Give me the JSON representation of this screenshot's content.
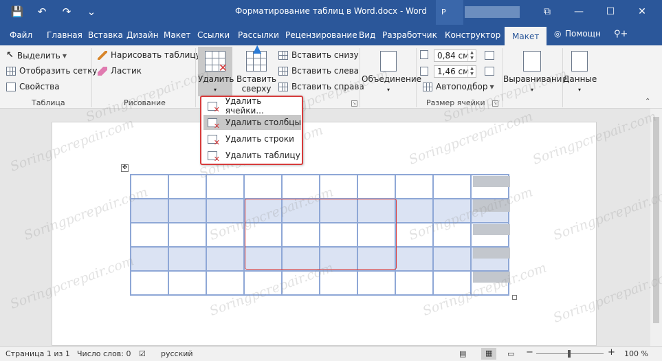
{
  "window": {
    "title": "Форматирование таблиц в Word.docx - Word",
    "user_initial": "Р",
    "controls": {
      "restore": "⧉",
      "minimize": "—",
      "maximize": "☐",
      "close": "✕"
    }
  },
  "quick_access": {
    "save": "💾",
    "undo": "↶",
    "redo": "↷",
    "customize": "⌄"
  },
  "tabs": [
    "Файл",
    "Главная",
    "Вставка",
    "Дизайн",
    "Макет",
    "Ссылки",
    "Рассылки",
    "Рецензирование",
    "Вид",
    "Разработчик",
    "Конструктор",
    "Макет"
  ],
  "tab_right": {
    "help": "Помощн",
    "share": "⚲+"
  },
  "ribbon": {
    "table_group": {
      "select": "Выделить",
      "show_grid": "Отобразить сетку",
      "properties": "Свойства",
      "label": "Таблица"
    },
    "draw_group": {
      "draw_table": "Нарисовать таблицу",
      "eraser": "Ластик",
      "label": "Рисование"
    },
    "delete_button": {
      "line1": "Удалить",
      "arrow": "▾"
    },
    "insert_above": {
      "line1": "Вставить",
      "line2": "сверху"
    },
    "insert_below": "Вставить снизу",
    "insert_left": "Вставить слева",
    "insert_right": "Вставить справа",
    "merge": {
      "line1": "Объединение",
      "arrow": "▾"
    },
    "cell_height": "0,84 см",
    "cell_width": "1,46 см",
    "autofit": "Автоподбор",
    "cell_size_label": "Размер ячейки",
    "alignment": {
      "line1": "Выравнивание",
      "arrow": "▾"
    },
    "data": {
      "line1": "Данные",
      "arrow": "▾"
    },
    "collapse": "⌃"
  },
  "delete_menu": {
    "cells": "Удалить ячейки...",
    "columns": "Удалить столбцы",
    "rows": "Удалить строки",
    "table": "Удалить таблицу"
  },
  "status": {
    "page": "Страница 1 из 1",
    "words": "Число слов: 0",
    "language": "русский",
    "zoom_out": "−",
    "zoom_in": "+",
    "zoom": "100 %"
  },
  "watermark": "Soringpcrepair.com",
  "colors": {
    "accent": "#2b579a",
    "selection": "#d63b3b",
    "table_border": "#8ea7d6"
  }
}
